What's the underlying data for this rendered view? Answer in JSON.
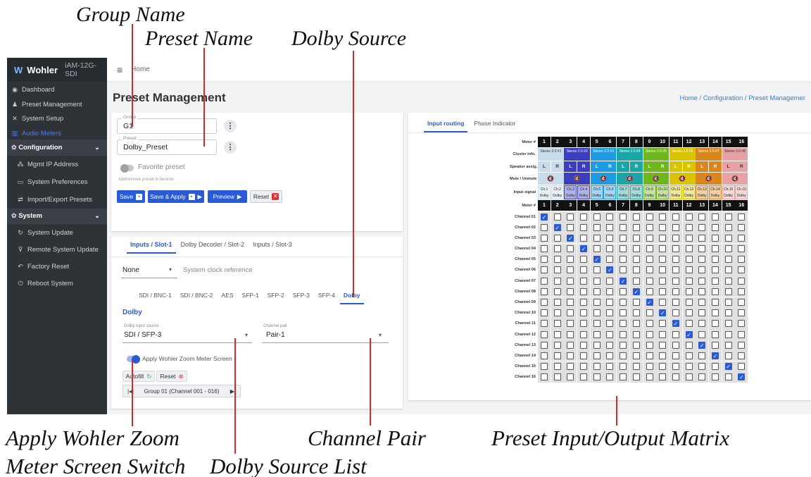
{
  "annotations": {
    "group_name": "Group Name",
    "preset_name": "Preset Name",
    "dolby_source": "Dolby Source",
    "apply_zoom_line1": "Apply Wohler Zoom",
    "apply_zoom_line2": "Meter Screen Switch",
    "dolby_source_list": "Dolby Source List",
    "channel_pair": "Channel Pair",
    "preset_matrix": "Preset Input/Output Matrix"
  },
  "sidebar": {
    "logo": "Wohler",
    "model": "iAM-12G-SDI",
    "items": [
      {
        "label": "Dashboard",
        "icon": "dashboard-icon",
        "glyph": "◉"
      },
      {
        "label": "Preset Management",
        "icon": "users-icon",
        "glyph": "♟"
      },
      {
        "label": "System Setup",
        "icon": "tools-icon",
        "glyph": "✕"
      },
      {
        "label": "Audio Meters",
        "icon": "chart-icon",
        "glyph": "▥"
      },
      {
        "label": "Configuration",
        "icon": "gear-icon",
        "glyph": "✿"
      },
      {
        "label": "Mgmt IP Address",
        "icon": "network-icon",
        "glyph": "⁂"
      },
      {
        "label": "System Preferences",
        "icon": "keyboard-icon",
        "glyph": "▭"
      },
      {
        "label": "Import/Export Presets",
        "icon": "swap-icon",
        "glyph": "⇄"
      },
      {
        "label": "System",
        "icon": "gears-icon",
        "glyph": "✿"
      },
      {
        "label": "System Update",
        "icon": "refresh-icon",
        "glyph": "↻"
      },
      {
        "label": "Remote System Update",
        "icon": "remote-icon",
        "glyph": "⊽"
      },
      {
        "label": "Factory Reset",
        "icon": "undo-icon",
        "glyph": "↶"
      },
      {
        "label": "Reboot System",
        "icon": "power-icon",
        "glyph": "⏻"
      }
    ]
  },
  "topbar": {
    "menu_glyph": "≡",
    "home": "Home"
  },
  "page": {
    "title": "Preset Management",
    "breadcrumb": "Home / Configuration / Preset Managemer"
  },
  "preset": {
    "group_label": "Group",
    "group_value": "G1",
    "preset_label": "Preset",
    "preset_value": "Dolby_Preset",
    "kebab": "⋮",
    "favorite_label": "Favorite preset",
    "favorite_hint": "Add/remove preset in favorite.",
    "save": "Save",
    "save_apply": "Save & Apply",
    "preview": "Preview",
    "reset": "Reset"
  },
  "inputs": {
    "slot_tabs": [
      "Inputs / Slot-1",
      "Dolby Decoder / Slot-2",
      "Inputs / Slot-3"
    ],
    "clock_value": "None",
    "clock_label": "System clock reference",
    "source_tabs": [
      "SDI / BNC-1",
      "SDI / BNC-2",
      "AES",
      "SFP-1",
      "SFP-2",
      "SFP-3",
      "SFP-4",
      "Dolby"
    ],
    "section_title": "Dolby",
    "dolby_source_label": "Dolby input source",
    "dolby_source_value": "SDI / SFP-3",
    "channel_pair_label": "Channel pair",
    "channel_pair_value": "Pair-1",
    "zoom_switch_label": "Apply Wohler Zoom Meter Screen",
    "autofill": "Autofill",
    "reset": "Reset",
    "group_nav": "Group 01 (Channel 001 - 016)"
  },
  "routing": {
    "tabs": [
      "Input routing",
      "Phase Indicator"
    ],
    "row_labels": {
      "meter": "Meter #",
      "cluster": "Cluster info.",
      "speaker": "Speaker assig.",
      "mute": "Mute / Unmute",
      "input_signal": "Input signal"
    },
    "meters": [
      "1",
      "2",
      "3",
      "4",
      "5",
      "6",
      "7",
      "8",
      "9",
      "10",
      "11",
      "12",
      "13",
      "14",
      "15",
      "16"
    ],
    "clusters": [
      "Stereo 2.0 #1",
      "Stereo 2.0 #2",
      "Stereo 2.0 #3",
      "Stereo 2.0 #4",
      "Stereo 2.0 #5",
      "Stereo 2.0 #6",
      "Stereo 2.0 #7",
      "Stereo 2.0 #8"
    ],
    "cluster_colors": [
      "#c9dced",
      "#3b3fbf",
      "#1e9ce3",
      "#1aa6a6",
      "#6fb51c",
      "#d8c400",
      "#d9861c",
      "#e7a3a3"
    ],
    "speakers": [
      "L",
      "R",
      "L",
      "R",
      "L",
      "R",
      "L",
      "R",
      "L",
      "R",
      "L",
      "R",
      "L",
      "R",
      "L",
      "R"
    ],
    "mute_glyph": "🔇",
    "input_signals": [
      "Ch.1 Dolby",
      "Ch.2 Dolby",
      "Ch.3 Dolby",
      "Ch.4 Dolby",
      "Ch.5 Dolby",
      "Ch.6 Dolby",
      "Ch.7 Dolby",
      "Ch.8 Dolby",
      "Ch.9 Dolby",
      "Ch.10 Dolby",
      "Ch.11 Dolby",
      "Ch.12 Dolby",
      "Ch.13 Dolby",
      "Ch.14 Dolby",
      "Ch.15 Dolby",
      "Ch.16 Dolby"
    ],
    "channels": [
      "Channel 01",
      "Channel 02",
      "Channel 03",
      "Channel 04",
      "Channel 05",
      "Channel 06",
      "Channel 07",
      "Channel 08",
      "Channel 09",
      "Channel 10",
      "Channel 11",
      "Channel 12",
      "Channel 13",
      "Channel 14",
      "Channel 15",
      "Channel 16"
    ],
    "checked_meter_per_channel": [
      1,
      2,
      3,
      4,
      5,
      6,
      7,
      8,
      9,
      10,
      11,
      12,
      13,
      14,
      15,
      16
    ]
  }
}
